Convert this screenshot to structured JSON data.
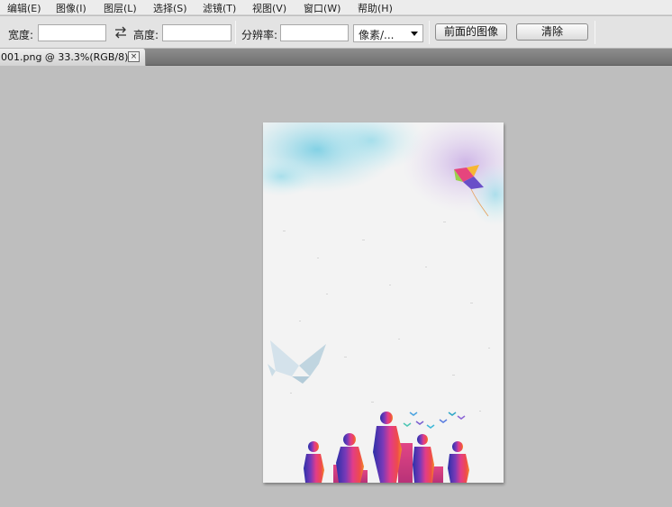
{
  "menubar": {
    "items": [
      {
        "label": "编辑(E)"
      },
      {
        "label": "图像(I)"
      },
      {
        "label": "图层(L)"
      },
      {
        "label": "选择(S)"
      },
      {
        "label": "滤镜(T)"
      },
      {
        "label": "视图(V)"
      },
      {
        "label": "窗口(W)"
      },
      {
        "label": "帮助(H)"
      }
    ]
  },
  "options": {
    "width_label": "宽度:",
    "width_value": "",
    "swap_icon": "swap-arrows-icon",
    "height_label": "高度:",
    "height_value": "",
    "resolution_label": "分辨率:",
    "resolution_value": "",
    "unit_selected": "像素/...",
    "front_image_button": "前面的图像",
    "clear_button": "清除"
  },
  "document": {
    "tab_title": "001.png @ 33.3%(RGB/8)",
    "close_icon": "close-icon",
    "close_glyph": "×"
  },
  "colors": {
    "workspace": "#bebebe",
    "paper": "#f3f3f3",
    "cloud_blue": "#7fd3e6",
    "cloud_purple": "#c7a8e0"
  }
}
